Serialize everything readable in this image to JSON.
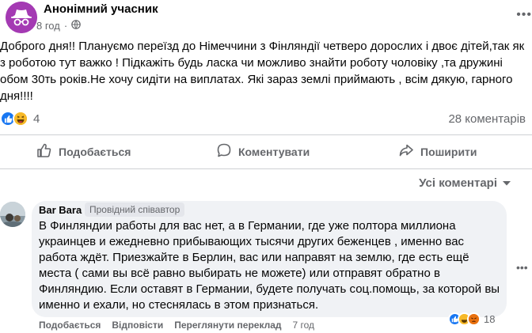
{
  "post": {
    "author": "Анонімний учасник",
    "time": "8 год",
    "more_label": "•••",
    "text": "Доброго дня!! Плануємо переїзд до Німеччини з Фінляндії четверо дорослих і двоє дітей,так як з роботою тут важко ! Підкажіть будь ласка чи можливо знайти роботу чоловіку ,та дружині обом 30ть років.Не хочу сидіти на виплатах. Які зараз землі приймають , всім дякую, гарного дня!!!!",
    "reaction_count": "4",
    "comments_count": "28 коментарів",
    "reaction_icons": [
      "like-icon",
      "haha-icon"
    ]
  },
  "actions": {
    "like": "Подобається",
    "comment": "Коментувати",
    "share": "Поширити"
  },
  "filter": {
    "label": "Усі коментарі"
  },
  "comment": {
    "author": "Bar Bara",
    "badge": "Провідний співавтор",
    "text": "В Финляндии работы для вас нет, а в Германии, где уже полтора миллиона украинцев и ежедневно прибывающих тысячи других беженцев , именно вас работа ждёт. Приезжайте в Берлин, вас или направят на землю, где есть ещё места ( сами вы всё равно выбирать не можете) или отправят обратно в Финляндию. Если оставят в Германии, будете получать соц.помощь, за которой вы именно и ехали, но стеснялась в этом признаться.",
    "like": "Подобається",
    "reply": "Відповісти",
    "translate": "Переглянути переклад",
    "time": "7 год",
    "reaction_count": "18",
    "reaction_icons": [
      "like-icon",
      "haha-icon",
      "angry-icon"
    ],
    "more_label": "•••"
  },
  "colors": {
    "accent": "#1877f2",
    "secondary_text": "#65676b",
    "bubble": "#f0f2f5",
    "anon_avatar": "#a43ab3"
  }
}
